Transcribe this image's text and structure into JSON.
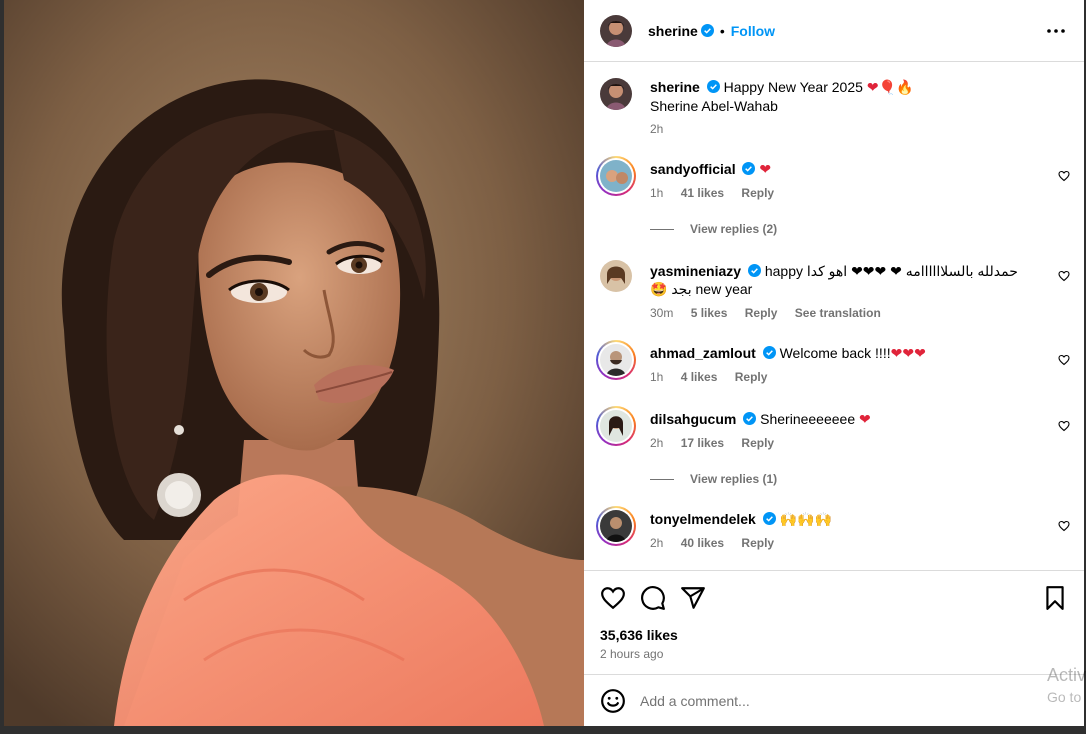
{
  "post": {
    "username": "sherine",
    "follow_label": "Follow",
    "dot": "•",
    "caption": "Happy New Year 2025",
    "caption_emojis": "❤🎈🔥",
    "caption_line2": "Sherine Abel-Wahab",
    "caption_time": "2h"
  },
  "comments": [
    {
      "username": "sandyofficial",
      "text": "",
      "emoji": "❤",
      "time": "1h",
      "likes": "41 likes",
      "reply": "Reply",
      "view_replies": "View replies (2)"
    },
    {
      "username": "yasmineniazy",
      "text_en": "happy",
      "text_ar": "حمدلله بالسلاااااامه ❤ ❤❤❤ اهو كدا",
      "line2": "new year",
      "line2_ar": "بجد 🤩",
      "time": "30m",
      "likes": "5 likes",
      "reply": "Reply",
      "translate": "See translation"
    },
    {
      "username": "ahmad_zamlout",
      "text": "Welcome back !!!!",
      "emoji": "❤❤❤",
      "time": "1h",
      "likes": "4 likes",
      "reply": "Reply"
    },
    {
      "username": "dilsahgucum",
      "text": "Sherineeeeeee",
      "emoji": "❤",
      "time": "2h",
      "likes": "17 likes",
      "reply": "Reply",
      "view_replies": "View replies (1)"
    },
    {
      "username": "tonyelmendelek",
      "text": "",
      "emoji": "🙌🙌🙌",
      "time": "2h",
      "likes": "40 likes",
      "reply": "Reply"
    }
  ],
  "actions": {
    "likes": "35,636 likes",
    "time": "2 hours ago"
  },
  "add_comment": {
    "placeholder": "Add a comment..."
  },
  "watermark": {
    "line1": "Activ",
    "line2": "Go to"
  },
  "colors": {
    "accent": "#0095f6",
    "heart": "#e0243a",
    "muted": "#737373",
    "border": "#dbdbdb"
  }
}
